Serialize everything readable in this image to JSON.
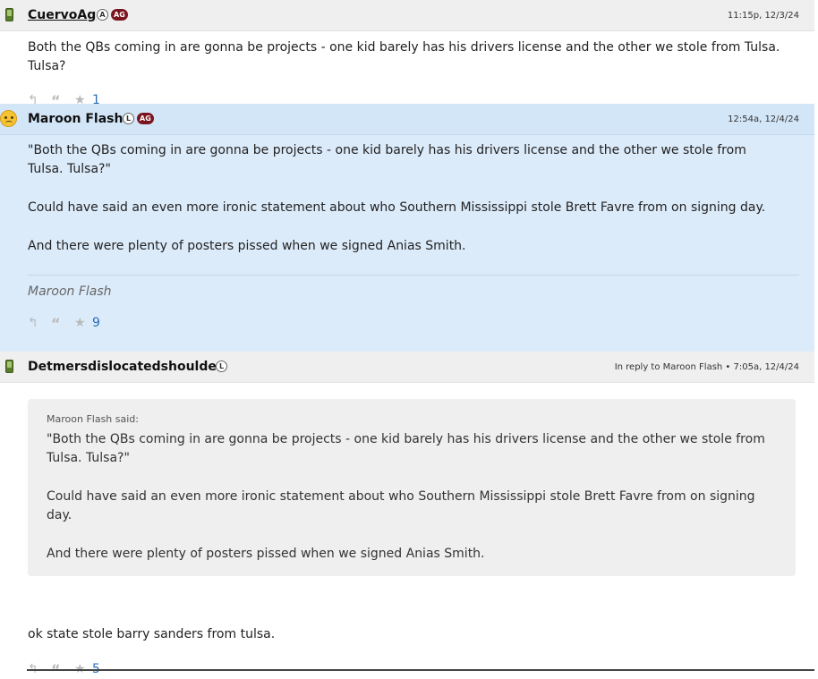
{
  "posts": [
    {
      "username": "CuervoAg",
      "badges": [
        "A",
        "AG"
      ],
      "timestamp": "11:15p, 12/3/24",
      "paragraphs": [
        "Both the QBs coming in are gonna be projects - one kid barely has his drivers license and the other we stole from Tulsa. Tulsa?"
      ],
      "likes": "1"
    },
    {
      "username": "Maroon Flash",
      "badges": [
        "L",
        "AG"
      ],
      "timestamp": "12:54a, 12/4/24",
      "paragraphs": [
        "\"Both the QBs coming in are gonna be projects - one kid barely has his drivers license and the other we stole from Tulsa. Tulsa?\"",
        "Could have said an even more ironic statement about who Southern Mississippi stole Brett Favre from on signing day.",
        "And there were plenty of posters pissed when we signed Anias Smith."
      ],
      "signature": "Maroon Flash",
      "likes": "9"
    },
    {
      "username": "Detmersdislocatedshoulder",
      "badges": [
        "L"
      ],
      "timestamp": "In reply to Maroon Flash • 7:05a, 12/4/24",
      "quote": {
        "author": "Maroon Flash said:",
        "paragraphs": [
          "\"Both the QBs coming in are gonna be projects - one kid barely has his drivers license and the other we stole from Tulsa. Tulsa?\"",
          "Could have said an even more ironic statement about who Southern Mississippi stole Brett Favre from on signing day.",
          "And there were plenty of posters pissed when we signed Anias Smith."
        ]
      },
      "reply": "ok state stole barry sanders from tulsa.",
      "likes": "5"
    }
  ],
  "icons": {
    "reply": "reply-icon",
    "quote": "quote-icon",
    "star": "star-icon",
    "device": "phone-icon",
    "emoji": "frown-face-icon"
  },
  "colors": {
    "highlight_bg": "#dcebfa",
    "badge_ag": "#7a1420",
    "like_count": "#2a6db8"
  }
}
